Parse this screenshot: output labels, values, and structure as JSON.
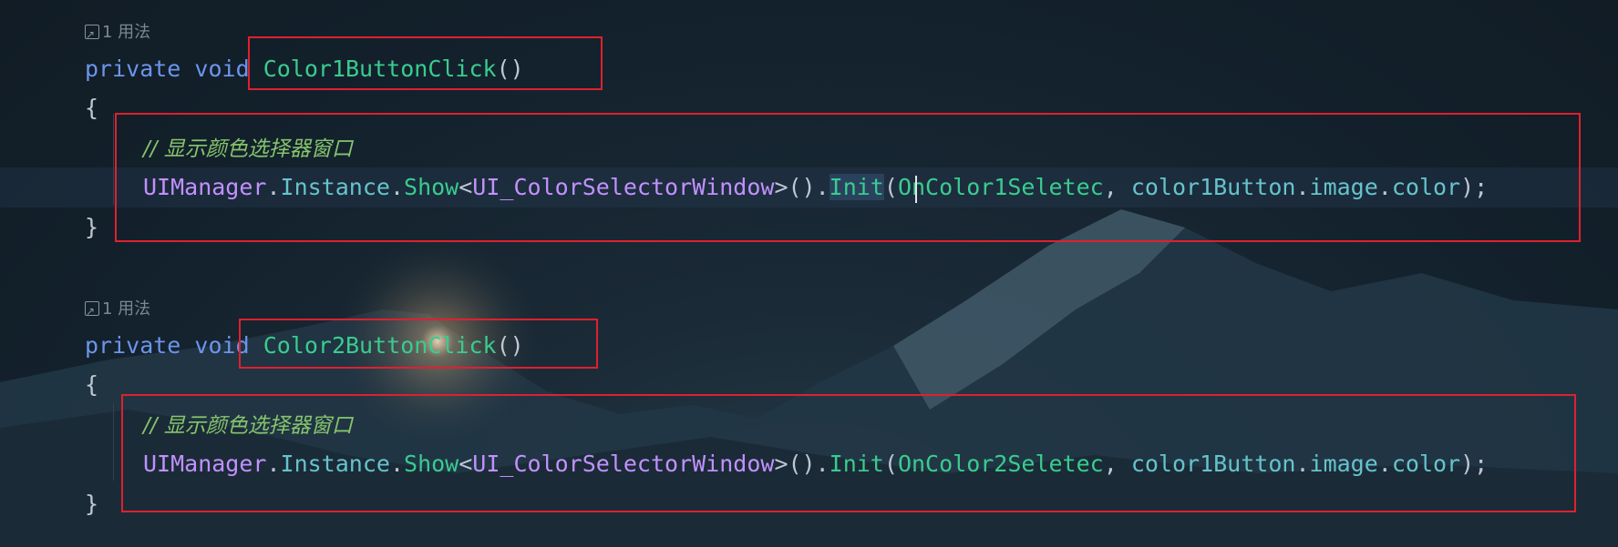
{
  "editor": {
    "blocks": [
      {
        "usage_hint": "1 用法",
        "signature": {
          "keyword_private": "private",
          "keyword_void": "void",
          "method_name": "Color1ButtonClick",
          "parens": "()"
        },
        "open_brace": "{",
        "comment": "// 显示颜色选择器窗口",
        "statement": {
          "class": "UIManager",
          "dot1": ".",
          "instance": "Instance",
          "dot2": ".",
          "show": "Show",
          "lt": "<",
          "generic": "UI_ColorSelectorWindow",
          "gt_call": ">().",
          "init": "Init",
          "open": "(",
          "arg1": "OnColor1Seletec",
          "comma": ", ",
          "arg2": "color1Button",
          "dot3": ".",
          "arg2b": "image",
          "dot4": ".",
          "arg2c": "color",
          "close": ");"
        },
        "close_brace": "}"
      },
      {
        "usage_hint": "1 用法",
        "signature": {
          "keyword_private": "private",
          "keyword_void": "void",
          "method_name": "Color2ButtonClick",
          "parens": "()"
        },
        "open_brace": "{",
        "comment": "// 显示颜色选择器窗口",
        "statement": {
          "class": "UIManager",
          "dot1": ".",
          "instance": "Instance",
          "dot2": ".",
          "show": "Show",
          "lt": "<",
          "generic": "UI_ColorSelectorWindow",
          "gt_call": ">().",
          "init": "Init",
          "open": "(",
          "arg1": "OnColor2Seletec",
          "comma": ", ",
          "arg2": "color1Button",
          "dot3": ".",
          "arg2b": "image",
          "dot4": ".",
          "arg2c": "color",
          "close": ");"
        },
        "close_brace": "}"
      }
    ]
  },
  "colors": {
    "keyword": "#6c95eb",
    "method": "#39cc8f",
    "class": "#c191ff",
    "member": "#66c3cc",
    "comment": "#85c46c",
    "annotation_box": "#e0202e"
  }
}
